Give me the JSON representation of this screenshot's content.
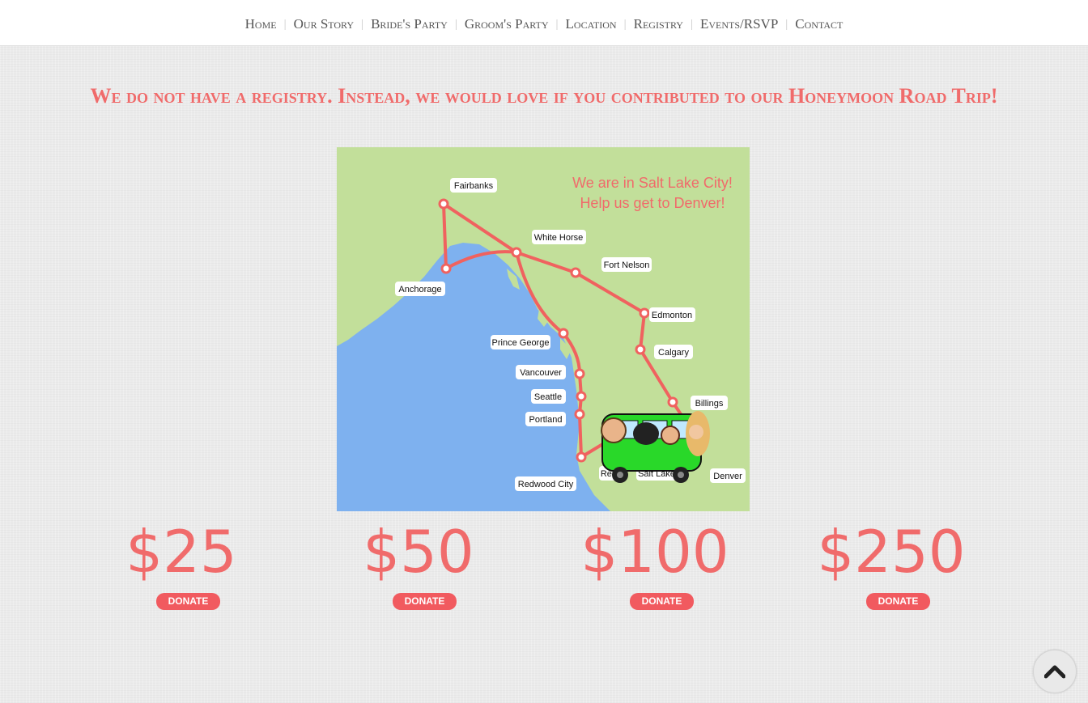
{
  "nav": {
    "items": [
      "Home",
      "Our Story",
      "Bride's Party",
      "Groom's Party",
      "Location",
      "Registry",
      "Events/RSVP",
      "Contact"
    ]
  },
  "headline": "We do not have a registry. Instead, we would love if you contributed to our Honeymoon Road Trip!",
  "map": {
    "callout_line1": "We are in Salt Lake City!",
    "callout_line2": "Help us get to Denver!",
    "cities": {
      "fairbanks": "Fairbanks",
      "white_horse": "White Horse",
      "fort_nelson": "Fort Nelson",
      "anchorage": "Anchorage",
      "edmonton": "Edmonton",
      "prince_george": "Prince George",
      "calgary": "Calgary",
      "vancouver": "Vancouver",
      "seattle": "Seattle",
      "portland": "Portland",
      "billings": "Billings",
      "reno": "Reno",
      "salt_lake": "Salt Lake",
      "redwood_city": "Redwood City",
      "denver": "Denver"
    }
  },
  "donations": [
    {
      "amount": "$25",
      "button": "DONATE"
    },
    {
      "amount": "$50",
      "button": "DONATE"
    },
    {
      "amount": "$100",
      "button": "DONATE"
    },
    {
      "amount": "$250",
      "button": "DONATE"
    }
  ],
  "colors": {
    "accent": "#f06b6b",
    "button": "#f15a5f",
    "land": "#c2df9a",
    "water": "#7eb1ef"
  },
  "scroll_top_icon": "chevron-up-icon"
}
